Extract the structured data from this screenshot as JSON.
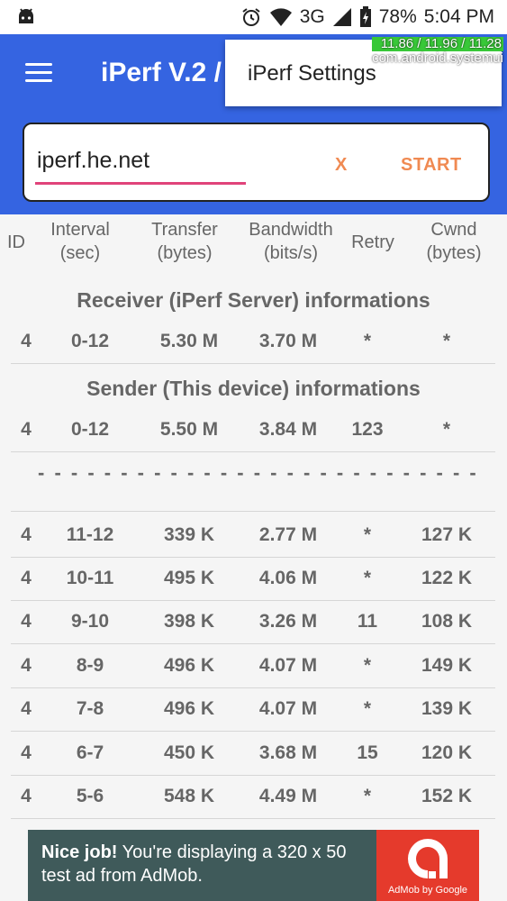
{
  "status": {
    "network": "3G",
    "battery": "78%",
    "time": "5:04 PM"
  },
  "overlay": {
    "cpu": "11.86 / 11.96 / 11.28",
    "process": "com.android.systemui"
  },
  "appbar": {
    "title": "iPerf V.2 /"
  },
  "menu": {
    "settings": "iPerf Settings"
  },
  "form": {
    "host": "iperf.he.net",
    "clear_label": "X",
    "start_label": "START"
  },
  "headers": {
    "id": "ID",
    "interval": [
      "Interval",
      "(sec)"
    ],
    "transfer": [
      "Transfer",
      "(bytes)"
    ],
    "bandwidth": [
      "Bandwidth",
      "(bits/s)"
    ],
    "retry": "Retry",
    "cwnd": [
      "Cwnd",
      "(bytes)"
    ]
  },
  "receiver": {
    "title": "Receiver (iPerf Server) informations",
    "row": {
      "id": "4",
      "interval": "0-12",
      "transfer": "5.30 M",
      "bandwidth": "3.70 M",
      "retry": "*",
      "cwnd": "*"
    }
  },
  "sender": {
    "title": "Sender (This device) informations",
    "row": {
      "id": "4",
      "interval": "0-12",
      "transfer": "5.50 M",
      "bandwidth": "3.84 M",
      "retry": "123",
      "cwnd": "*"
    }
  },
  "separator": "- - - - - - - - - - - - - - - - - - - - - - - - - - -",
  "intervals": [
    {
      "id": "4",
      "interval": "11-12",
      "transfer": "339 K",
      "bandwidth": "2.77 M",
      "retry": "*",
      "cwnd": "127 K"
    },
    {
      "id": "4",
      "interval": "10-11",
      "transfer": "495 K",
      "bandwidth": "4.06 M",
      "retry": "*",
      "cwnd": "122 K"
    },
    {
      "id": "4",
      "interval": "9-10",
      "transfer": "398 K",
      "bandwidth": "3.26 M",
      "retry": "11",
      "cwnd": "108 K"
    },
    {
      "id": "4",
      "interval": "8-9",
      "transfer": "496 K",
      "bandwidth": "4.07 M",
      "retry": "*",
      "cwnd": "149 K"
    },
    {
      "id": "4",
      "interval": "7-8",
      "transfer": "496 K",
      "bandwidth": "4.07 M",
      "retry": "*",
      "cwnd": "139 K"
    },
    {
      "id": "4",
      "interval": "6-7",
      "transfer": "450 K",
      "bandwidth": "3.68 M",
      "retry": "15",
      "cwnd": "120 K"
    },
    {
      "id": "4",
      "interval": "5-6",
      "transfer": "548 K",
      "bandwidth": "4.49 M",
      "retry": "*",
      "cwnd": "152 K"
    }
  ],
  "ad": {
    "headline": "Nice job!",
    "body": "You're displaying a 320 x 50 test ad from AdMob.",
    "attribution": "AdMob by Google"
  },
  "colors": {
    "appbar": "#3564e1",
    "accent": "#f08a52",
    "underline": "#e0437a",
    "ad_bg": "#3f5a5a",
    "ad_logo": "#e53a2c"
  }
}
